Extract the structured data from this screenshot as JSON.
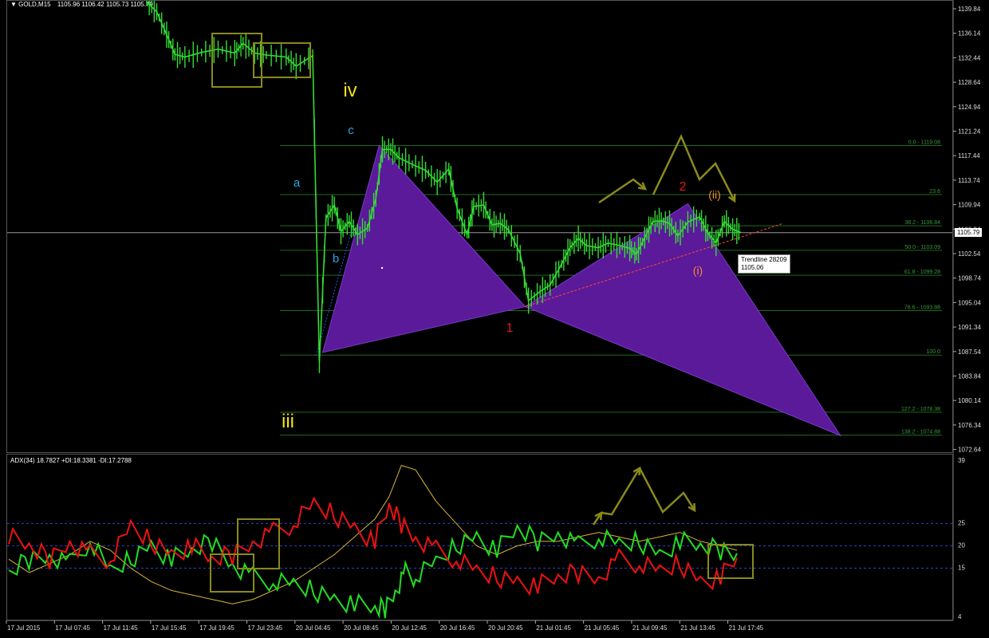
{
  "header": {
    "symbol": "GOLD,M15",
    "quote": "1105.96 1106.42 1105.73 1105.79"
  },
  "price_axis": {
    "ticks": [
      "1139.84",
      "1136.14",
      "1132.44",
      "1128.64",
      "1124.94",
      "1121.24",
      "1117.44",
      "1113.74",
      "1109.94",
      "1106.24",
      "1102.54",
      "1098.74",
      "1095.04",
      "1091.34",
      "1087.54",
      "1083.84",
      "1080.14",
      "1076.34",
      "1072.64"
    ],
    "current_price": "1105.79"
  },
  "adx_axis": {
    "ticks": [
      "39",
      "25",
      "20",
      "15",
      "4"
    ]
  },
  "time_axis": {
    "labels": [
      "17 Jul 2015",
      "17 Jul 07:45",
      "17 Jul 11:45",
      "17 Jul 15:45",
      "17 Jul 19:45",
      "17 Jul 23:45",
      "20 Jul 04:45",
      "20 Jul 08:45",
      "20 Jul 12:45",
      "20 Jul 16:45",
      "20 Jul 20:45",
      "21 Jul 01:45",
      "21 Jul 05:45",
      "21 Jul 09:45",
      "21 Jul 13:45",
      "21 Jul 17:45"
    ]
  },
  "fibonacci": [
    {
      "label": "0.0 - 1119.08",
      "price": 1119.08
    },
    {
      "label": "23.6",
      "price": 1111.6
    },
    {
      "label": "38.2 - 1106.84",
      "price": 1106.84
    },
    {
      "label": "50.0 - 1103.09",
      "price": 1103.09
    },
    {
      "label": "61.8 - 1099.28",
      "price": 1099.28
    },
    {
      "label": "78.6 - 1093.88",
      "price": 1093.88
    },
    {
      "label": "100.0",
      "price": 1087.1
    },
    {
      "label": "127.2 - 1078.38",
      "price": 1078.38
    },
    {
      "label": "138.2 - 1074.88",
      "price": 1074.88
    }
  ],
  "wave_labels": {
    "iv": "iv",
    "iii": "iii",
    "a": "a",
    "b": "b",
    "c": "c",
    "one": "1",
    "two": "2",
    "sub_i": "(i)",
    "sub_ii": "(ii)"
  },
  "trendline_tooltip": {
    "name": "Trendline 28209",
    "value": "1105.06"
  },
  "adx_header": "ADX(34) 18.7827 +DI:18.3381 -DI:17.2788",
  "colors": {
    "candles": "#33dd33",
    "pattern_fill": "#5a1a9a",
    "fib_line": "#1d6b1d",
    "box": "#8a8a1a",
    "plus_di": "#22dd22",
    "minus_di": "#ee1111",
    "adx": "#d9b23a",
    "level_line": "#2a45c8"
  },
  "chart_data": {
    "type": "line",
    "instrument": "GOLD,M15",
    "ylim": [
      1072.64,
      1141.5
    ],
    "price_path": [
      [
        0,
        1141
      ],
      [
        6,
        1139.5
      ],
      [
        12,
        1136
      ],
      [
        17,
        1133
      ],
      [
        23,
        1132.6
      ],
      [
        33,
        1133.3
      ],
      [
        43,
        1133.8
      ],
      [
        53,
        1133.2
      ],
      [
        58,
        1134.7
      ],
      [
        65,
        1133.2
      ],
      [
        72,
        1132.9
      ],
      [
        84,
        1132.6
      ],
      [
        90,
        1131.2
      ],
      [
        100,
        1132.8
      ],
      [
        104,
        1086
      ],
      [
        108,
        1108
      ],
      [
        113,
        1110
      ],
      [
        117,
        1106
      ],
      [
        122,
        1107.5
      ],
      [
        127,
        1105.5
      ],
      [
        133,
        1106.5
      ],
      [
        138,
        1111
      ],
      [
        142,
        1118.5
      ],
      [
        147,
        1118.5
      ],
      [
        152,
        1117.2
      ],
      [
        160,
        1116.2
      ],
      [
        168,
        1115.3
      ],
      [
        175,
        1113.5
      ],
      [
        182,
        1115.5
      ],
      [
        187,
        1109.5
      ],
      [
        193,
        1105.5
      ],
      [
        197,
        1109.8
      ],
      [
        203,
        1110
      ],
      [
        208,
        1107
      ],
      [
        213,
        1107.2
      ],
      [
        218,
        1106.2
      ],
      [
        225,
        1102.6
      ],
      [
        230,
        1095.4
      ],
      [
        237,
        1096.8
      ],
      [
        243,
        1097.8
      ],
      [
        250,
        1101
      ],
      [
        255,
        1103.5
      ],
      [
        260,
        1104.9
      ],
      [
        265,
        1103.8
      ],
      [
        272,
        1103.5
      ],
      [
        278,
        1104.2
      ],
      [
        285,
        1103.8
      ],
      [
        291,
        1103.4
      ],
      [
        295,
        1102.5
      ],
      [
        300,
        1105
      ],
      [
        305,
        1107.5
      ],
      [
        310,
        1107.6
      ],
      [
        315,
        1107.2
      ],
      [
        320,
        1105.3
      ],
      [
        326,
        1107.4
      ],
      [
        333,
        1108.2
      ],
      [
        338,
        1105.8
      ],
      [
        343,
        1104.2
      ],
      [
        348,
        1107.5
      ],
      [
        353,
        1106.3
      ],
      [
        358,
        1105.8
      ]
    ],
    "adx": {
      "ylim": [
        4,
        39
      ],
      "levels": [
        25,
        20,
        15
      ],
      "series": [
        {
          "name": "ADX(34)",
          "values": [
            [
              0,
              17
            ],
            [
              10,
              14
            ],
            [
              20,
              16
            ],
            [
              30,
              18
            ],
            [
              40,
              21
            ],
            [
              50,
              19
            ],
            [
              60,
              15
            ],
            [
              70,
              12
            ],
            [
              80,
              10
            ],
            [
              90,
              9
            ],
            [
              100,
              8
            ],
            [
              110,
              7
            ],
            [
              120,
              8
            ],
            [
              130,
              10
            ],
            [
              140,
              12
            ],
            [
              150,
              15
            ],
            [
              160,
              18
            ],
            [
              170,
              22
            ],
            [
              180,
              26
            ],
            [
              187,
              31
            ],
            [
              193,
              38
            ],
            [
              200,
              37
            ],
            [
              210,
              30
            ],
            [
              220,
              25
            ],
            [
              230,
              20
            ],
            [
              240,
              18
            ],
            [
              250,
              20
            ],
            [
              260,
              21
            ],
            [
              270,
              21
            ],
            [
              280,
              22
            ],
            [
              290,
              23
            ],
            [
              300,
              22
            ],
            [
              310,
              21
            ],
            [
              320,
              22
            ],
            [
              330,
              23
            ],
            [
              340,
              21
            ],
            [
              350,
              20
            ],
            [
              358,
              19
            ]
          ]
        },
        {
          "name": "+DI",
          "values": [
            [
              0,
              14
            ],
            [
              10,
              17
            ],
            [
              20,
              18
            ],
            [
              30,
              16
            ],
            [
              40,
              21
            ],
            [
              50,
              14
            ],
            [
              60,
              17
            ],
            [
              70,
              20
            ],
            [
              80,
              17
            ],
            [
              90,
              19
            ],
            [
              100,
              21
            ],
            [
              110,
              16
            ],
            [
              120,
              13
            ],
            [
              130,
              12
            ],
            [
              140,
              11
            ],
            [
              150,
              10
            ],
            [
              160,
              8
            ],
            [
              170,
              7
            ],
            [
              180,
              6
            ],
            [
              185,
              6
            ],
            [
              190,
              10
            ],
            [
              195,
              14
            ],
            [
              200,
              13
            ],
            [
              210,
              16
            ],
            [
              220,
              20
            ],
            [
              230,
              22
            ],
            [
              240,
              19
            ],
            [
              250,
              24
            ],
            [
              260,
              21
            ],
            [
              270,
              23
            ],
            [
              280,
              20
            ],
            [
              290,
              22
            ],
            [
              300,
              20
            ],
            [
              310,
              21
            ],
            [
              320,
              18
            ],
            [
              330,
              21
            ],
            [
              340,
              20
            ],
            [
              350,
              19
            ],
            [
              358,
              18.3
            ]
          ]
        },
        {
          "name": "-DI",
          "values": [
            [
              0,
              22
            ],
            [
              10,
              20
            ],
            [
              20,
              17
            ],
            [
              30,
              21
            ],
            [
              40,
              18
            ],
            [
              50,
              17
            ],
            [
              60,
              24
            ],
            [
              70,
              21
            ],
            [
              80,
              18
            ],
            [
              90,
              20
            ],
            [
              100,
              17
            ],
            [
              110,
              18
            ],
            [
              120,
              21
            ],
            [
              130,
              23
            ],
            [
              140,
              25
            ],
            [
              150,
              29
            ],
            [
              160,
              27
            ],
            [
              170,
              24
            ],
            [
              180,
              21
            ],
            [
              187,
              29
            ],
            [
              193,
              25
            ],
            [
              200,
              22
            ],
            [
              210,
              19
            ],
            [
              220,
              17
            ],
            [
              230,
              14
            ],
            [
              240,
              13
            ],
            [
              250,
              12
            ],
            [
              260,
              11
            ],
            [
              270,
              13
            ],
            [
              280,
              14
            ],
            [
              290,
              13
            ],
            [
              300,
              17
            ],
            [
              310,
              16
            ],
            [
              320,
              14
            ],
            [
              330,
              16
            ],
            [
              340,
              12
            ],
            [
              350,
              13
            ],
            [
              358,
              17.3
            ]
          ]
        }
      ]
    }
  }
}
